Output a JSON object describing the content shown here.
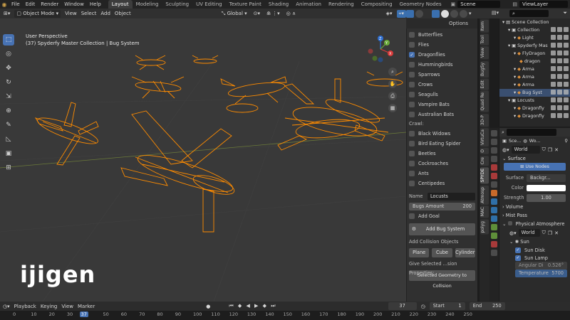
{
  "app": {
    "menus": [
      "File",
      "Edit",
      "Render",
      "Window",
      "Help"
    ],
    "workspaces": [
      "Layout",
      "Modeling",
      "Sculpting",
      "UV Editing",
      "Texture Paint",
      "Shading",
      "Animation",
      "Rendering",
      "Compositing",
      "Geometry Nodes"
    ],
    "active_workspace": "Layout",
    "scene": "Scene",
    "view_layer": "ViewLayer"
  },
  "viewport_header": {
    "mode": "Object Mode",
    "menus": [
      "View",
      "Select",
      "Add",
      "Object"
    ],
    "transform": "Global",
    "options": "Options"
  },
  "viewport": {
    "view_name": "User Perspective",
    "collection_info": "(37) Spyderfy Master Collection | Bug System",
    "accent": "#ff8c00",
    "gizmo_axes": [
      "Y",
      "X",
      "Z"
    ]
  },
  "sidepanel": {
    "fly_items": [
      {
        "label": "Butterflies",
        "checked": false
      },
      {
        "label": "Flies",
        "checked": false
      },
      {
        "label": "Dragonflies",
        "checked": true
      },
      {
        "label": "Hummingbirds",
        "checked": false
      },
      {
        "label": "Sparrows",
        "checked": false
      },
      {
        "label": "Crows",
        "checked": false
      },
      {
        "label": "Seagulls",
        "checked": false
      },
      {
        "label": "Vampire Bats",
        "checked": false
      },
      {
        "label": "Australian Bats",
        "checked": false
      }
    ],
    "crawl_label": "Crawl:",
    "crawl_items": [
      {
        "label": "Black Widows",
        "checked": false
      },
      {
        "label": "Bird Eating Spider",
        "checked": false
      },
      {
        "label": "Beetles",
        "checked": false
      },
      {
        "label": "Cockroaches",
        "checked": false
      },
      {
        "label": "Ants",
        "checked": false
      },
      {
        "label": "Centipedes",
        "checked": false
      }
    ],
    "name_label": "Name",
    "name_value": "Locusts",
    "bugs_amount_label": "Bugs Amount",
    "bugs_amount_value": "200",
    "add_goal": "Add Goal",
    "add_bug_system": "Add Bug System",
    "collision_label": "Add Collision Objects Below:",
    "collision_buttons": [
      "Plane",
      "Cube",
      "Cylinder"
    ],
    "give_selected": "Give Selected ...sion Properties:",
    "selected_geometry": "Selected Geometry to Collision"
  },
  "vertical_tabs": [
    "Item",
    "Tool",
    "View",
    "BugSy",
    "Edit",
    "Quad Re",
    "3D-P",
    "VirtuCa",
    "O",
    "Cre",
    "SPYDE",
    "Atmosp",
    "MAC",
    "polyg"
  ],
  "outliner": {
    "rows": [
      {
        "label": "Scene Collection",
        "indent": 0,
        "selected": false
      },
      {
        "label": "Collection",
        "indent": 1,
        "selected": false
      },
      {
        "label": "Light",
        "indent": 2,
        "selected": false
      },
      {
        "label": "Spyderfy Mas",
        "indent": 1,
        "selected": false
      },
      {
        "label": "FlyDragon",
        "indent": 2,
        "selected": false
      },
      {
        "label": "dragon",
        "indent": 3,
        "selected": false
      },
      {
        "label": "Arma",
        "indent": 2,
        "selected": false
      },
      {
        "label": "Arma",
        "indent": 2,
        "selected": false
      },
      {
        "label": "Arma",
        "indent": 2,
        "selected": false
      },
      {
        "label": "Bug Syst",
        "indent": 2,
        "selected": true
      },
      {
        "label": "Locusts",
        "indent": 1,
        "selected": false
      },
      {
        "label": "Dragonfly",
        "indent": 2,
        "selected": false
      },
      {
        "label": "Dragonfly",
        "indent": 2,
        "selected": false
      }
    ]
  },
  "properties": {
    "breadcrumb": [
      "Sce...",
      "Wo..."
    ],
    "world_name": "World",
    "surface_label": "Surface",
    "use_nodes": "Use Nodes",
    "surface_field_label": "Surface",
    "surface_value": "Backgr...",
    "color_label": "Color",
    "strength_label": "Strength",
    "strength_value": "1.00",
    "volume_label": "Volume",
    "mist_pass_label": "Mist Pass",
    "physical_atmosphere_label": "Physical Atmosphere",
    "atmo_world": "World",
    "sun_label": "Sun",
    "sun_disk": "Sun Disk",
    "sun_lamp": "Sun Lamp",
    "angular_label": "Angular Di",
    "angular_value": "0.526°",
    "temperature_label": "Temperature",
    "temperature_value": "5700"
  },
  "timeline": {
    "menus": [
      "Playback",
      "Keying",
      "View",
      "Marker"
    ],
    "current_frame": "37",
    "start_label": "Start",
    "start_value": "1",
    "end_label": "End",
    "end_value": "250",
    "ticks": [
      "0",
      "10",
      "20",
      "30",
      "37",
      "50",
      "60",
      "70",
      "80",
      "90",
      "100",
      "110",
      "120",
      "130",
      "140",
      "150",
      "160",
      "170",
      "180",
      "190",
      "200",
      "210",
      "220",
      "230",
      "240",
      "250"
    ]
  },
  "watermark": "ijigen"
}
